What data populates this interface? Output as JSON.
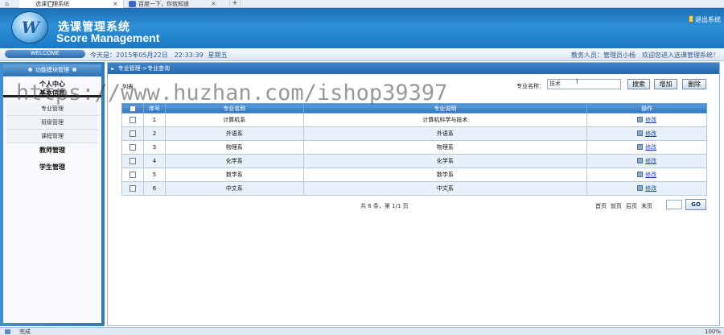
{
  "browser": {
    "tabs": [
      {
        "label": "选课管理系统"
      },
      {
        "label": "百度一下，你就知道"
      }
    ],
    "close_glyph": "×",
    "new_tab_glyph": "+"
  },
  "header": {
    "logo_letter": "W",
    "title_cn": "选课管理系统",
    "title_en": "Score Management",
    "exit_label": "退出系统"
  },
  "infobar": {
    "welcome": "WELCOME",
    "today": "今天是：2015年05月22日　22:33:39",
    "weekday": "星期五",
    "user": "教务人员：管理员小杨",
    "greeting": "欢迎您进入选课管理系统！"
  },
  "sidebar": {
    "title": "功能模块管理",
    "groups": [
      {
        "label": "个人中心"
      },
      {
        "label": "基本信息"
      },
      {
        "label": "教师管理"
      },
      {
        "label": "学生管理"
      }
    ],
    "items": [
      {
        "label": "专业管理"
      },
      {
        "label": "班级管理"
      },
      {
        "label": "课程管理"
      }
    ]
  },
  "main": {
    "breadcrumb": "专业管理->专业查询",
    "cut_label": "列表",
    "search_label": "专业名称：",
    "search_value": "技术",
    "btn_search": "搜索",
    "btn_add": "增加",
    "btn_delete": "删除",
    "columns": [
      "序号",
      "专业名称",
      "专业说明",
      "操作"
    ],
    "edit_label": "修改",
    "rows": [
      {
        "no": "1",
        "name": "计算机系",
        "desc": "计算机科学与技术"
      },
      {
        "no": "2",
        "name": "外语系",
        "desc": "外语系"
      },
      {
        "no": "3",
        "name": "物理系",
        "desc": "物理系"
      },
      {
        "no": "4",
        "name": "化学系",
        "desc": "化学系"
      },
      {
        "no": "5",
        "name": "数学系",
        "desc": "数学系"
      },
      {
        "no": "6",
        "name": "中文系",
        "desc": "中文系"
      }
    ],
    "pager_info": "共 6 条，第 1/1 页",
    "first": "首页",
    "prev": "前页",
    "next": "后页",
    "last": "末页",
    "go": "GO"
  },
  "watermark": "https://www.huzhan.com/ishop39397",
  "status": {
    "text": "完成",
    "zoom": "100%"
  }
}
